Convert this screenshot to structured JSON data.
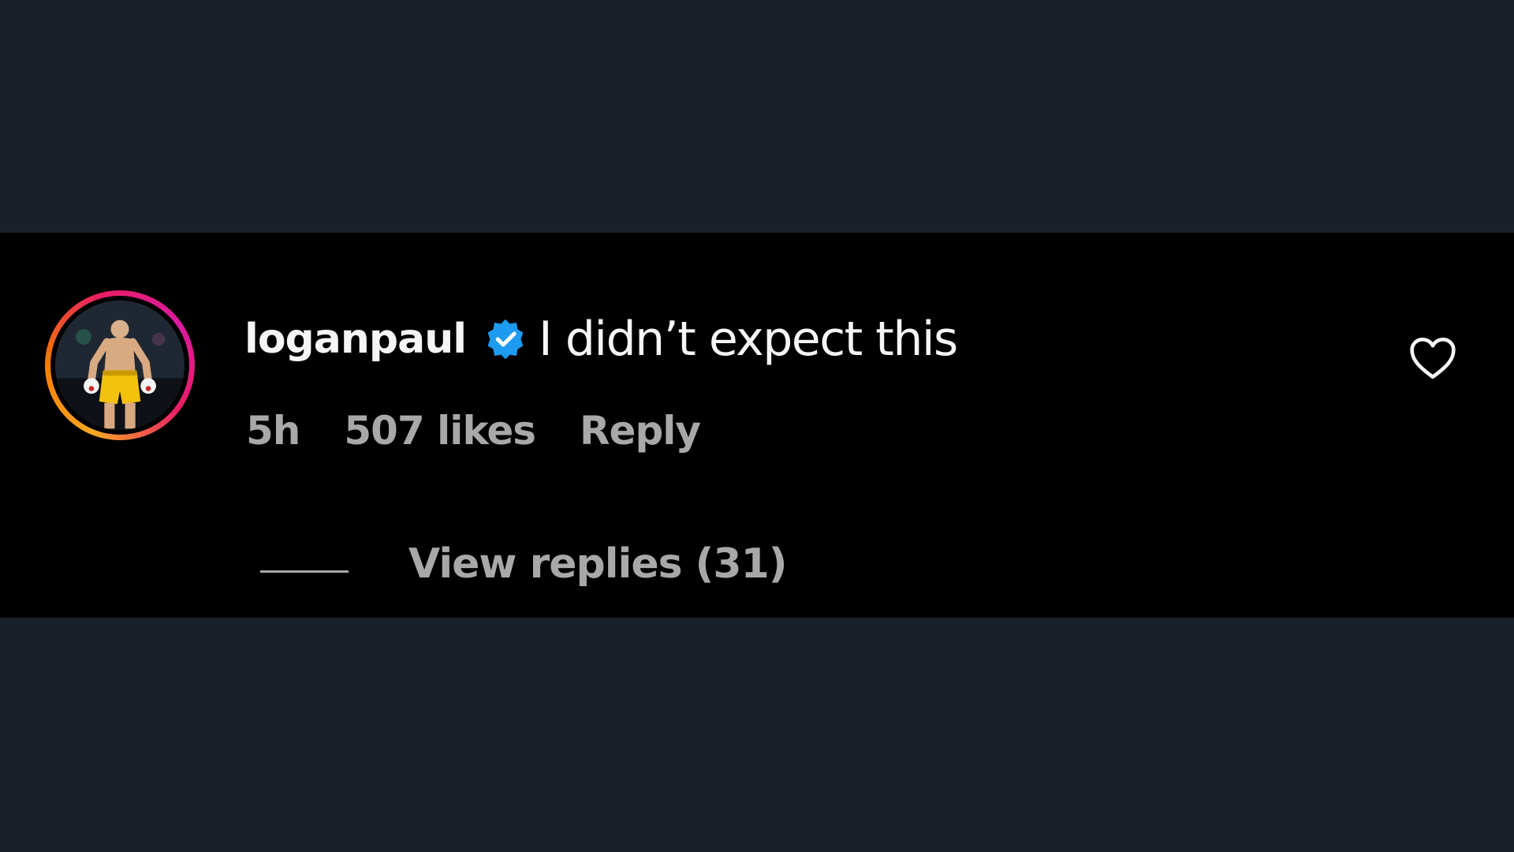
{
  "comment": {
    "username": "loganpaul",
    "verified_icon": "verified-badge-icon",
    "text": "I didn’t expect this",
    "time_ago": "5h",
    "likes": "507 likes",
    "reply_label": "Reply",
    "like_icon": "heart-outline-icon",
    "view_replies_label": "View replies (31)"
  },
  "colors": {
    "page_background": "#1a202a",
    "panel_background": "#000000",
    "verified_blue": "#1d9bf0",
    "primary_text": "#f5f5f5",
    "secondary_text": "#a8a8a8"
  }
}
